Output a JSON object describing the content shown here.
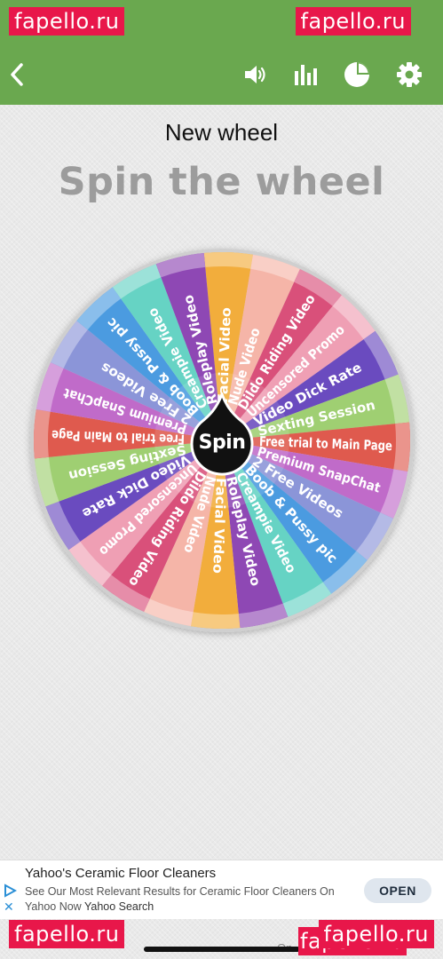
{
  "watermarks": [
    "fapello.ru",
    "fapello.ru",
    "fapello.ru",
    "fapello.ru",
    "fapello.ru"
  ],
  "toolbar": {
    "back_icon": "chevron-left-icon",
    "sound_icon": "speaker-icon",
    "chart_icon": "bar-chart-icon",
    "pie_icon": "pie-chart-icon",
    "settings_icon": "gear-icon",
    "background_color": "#6aa84f"
  },
  "wheel_name": "New wheel",
  "page_heading": "Spin the wheel",
  "wheel": {
    "center_label": "Spin",
    "segments": [
      {
        "label": "Facial Video",
        "color": "#f2ad3c"
      },
      {
        "label": "Nude Video",
        "color": "#f5b5a8"
      },
      {
        "label": "Dildo Riding Video",
        "color": "#d9507a"
      },
      {
        "label": "Uncensored Promo",
        "color": "#ef9fb4"
      },
      {
        "label": "Video Dick Rate",
        "color": "#6a4bbf"
      },
      {
        "label": "Sexting Session",
        "color": "#9fcf72"
      },
      {
        "label": "Free trial to Main Page",
        "color": "#df5a4e"
      },
      {
        "label": "Premium SnapChat",
        "color": "#c06bc9"
      },
      {
        "label": "2 Free Videos",
        "color": "#8b95d8"
      },
      {
        "label": "Boob & Pussy pic",
        "color": "#4b9be0"
      },
      {
        "label": "Creampie Video",
        "color": "#66d3c4"
      },
      {
        "label": "Roleplay Video",
        "color": "#8e48b4"
      },
      {
        "label": "Facial Video",
        "color": "#f2ad3c"
      },
      {
        "label": "Nude Video",
        "color": "#f5b5a8"
      },
      {
        "label": "Dildo Riding Video",
        "color": "#d9507a"
      },
      {
        "label": "Uncensored Promo",
        "color": "#ef9fb4"
      },
      {
        "label": "Video Dick Rate",
        "color": "#6a4bbf"
      },
      {
        "label": "Sexting Session",
        "color": "#9fcf72"
      },
      {
        "label": "Free trial to Main Page",
        "color": "#df5a4e"
      },
      {
        "label": "Premium SnapChat",
        "color": "#c06bc9"
      },
      {
        "label": "2 Free Videos",
        "color": "#8b95d8"
      },
      {
        "label": "Boob & Pussy pic",
        "color": "#4b9be0"
      },
      {
        "label": "Creampie Video",
        "color": "#66d3c4"
      },
      {
        "label": "Roleplay Video",
        "color": "#8e48b4"
      }
    ]
  },
  "ad": {
    "title": "Yahoo's Ceramic Floor Cleaners",
    "description": "See Our Most Relevant Results for Ceramic Floor Cleaners On Yahoo Now",
    "source": "Yahoo Search",
    "cta": "OPEN"
  },
  "bottom_label": "On"
}
